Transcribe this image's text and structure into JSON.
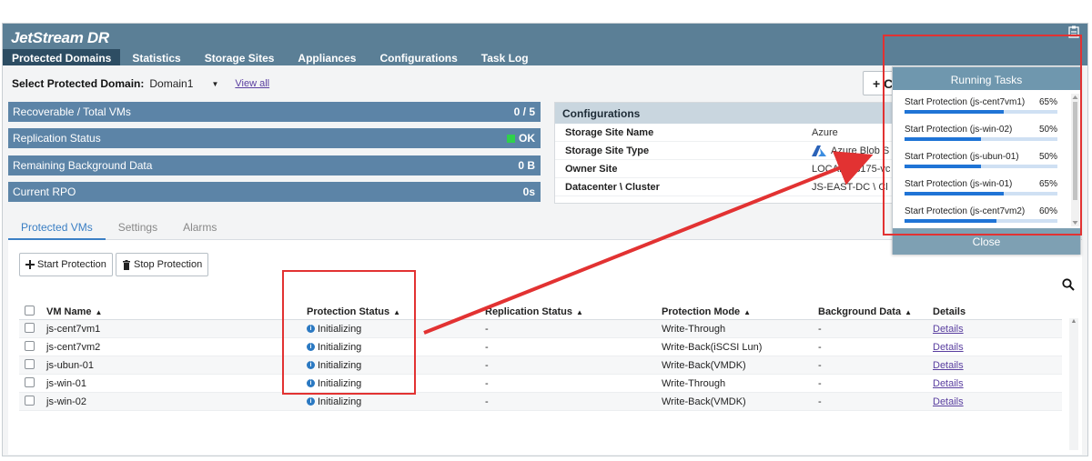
{
  "app": {
    "brand": "JetStream DR",
    "nav": [
      "Protected Domains",
      "Statistics",
      "Storage Sites",
      "Appliances",
      "Configurations",
      "Task Log"
    ],
    "active_nav": "Protected Domains"
  },
  "domain_select": {
    "label": "Select Protected Domain:",
    "value": "Domain1",
    "view_all": "View all"
  },
  "metrics": [
    {
      "label": "Recoverable / Total VMs",
      "value": "0 / 5"
    },
    {
      "label": "Replication Status",
      "value": "OK"
    },
    {
      "label": "Remaining Background Data",
      "value": "0 B"
    },
    {
      "label": "Current RPO",
      "value": "0s"
    }
  ],
  "configurations": {
    "title": "Configurations",
    "rows": [
      {
        "key": "Storage Site Name",
        "value": "Azure"
      },
      {
        "key": "Storage Site Type",
        "value": "Azure Blob S"
      },
      {
        "key": "Owner Site",
        "value": "LOCAL ( is175-vc"
      },
      {
        "key": "Datacenter \\ Cluster",
        "value": "JS-EAST-DC \\ Cl"
      }
    ]
  },
  "add_button": "+ C",
  "tabs": [
    "Protected VMs",
    "Settings",
    "Alarms"
  ],
  "toolbar": {
    "start_protection": "Start Protection",
    "stop_protection": "Stop Protection"
  },
  "table": {
    "columns": [
      "VM Name",
      "Protection Status",
      "Replication Status",
      "Protection Mode",
      "Background Data",
      "Details"
    ],
    "rows": [
      {
        "name": "js-cent7vm1",
        "status": "Initializing",
        "replication": "-",
        "mode": "Write-Through",
        "background": "-",
        "details": "Details"
      },
      {
        "name": "js-cent7vm2",
        "status": "Initializing",
        "replication": "-",
        "mode": "Write-Back(iSCSI Lun)",
        "background": "-",
        "details": "Details"
      },
      {
        "name": "js-ubun-01",
        "status": "Initializing",
        "replication": "-",
        "mode": "Write-Back(VMDK)",
        "background": "-",
        "details": "Details"
      },
      {
        "name": "js-win-01",
        "status": "Initializing",
        "replication": "-",
        "mode": "Write-Through",
        "background": "-",
        "details": "Details"
      },
      {
        "name": "js-win-02",
        "status": "Initializing",
        "replication": "-",
        "mode": "Write-Back(VMDK)",
        "background": "-",
        "details": "Details"
      }
    ]
  },
  "running_tasks": {
    "title": "Running Tasks",
    "close_label": "Close",
    "tasks": [
      {
        "label": "Start Protection (js-cent7vm1)",
        "percent": "65%",
        "progress": 0.65
      },
      {
        "label": "Start Protection (js-win-02)",
        "percent": "50%",
        "progress": 0.5
      },
      {
        "label": "Start Protection (js-ubun-01)",
        "percent": "50%",
        "progress": 0.5
      },
      {
        "label": "Start Protection (js-win-01)",
        "percent": "65%",
        "progress": 0.65
      },
      {
        "label": "Start Protection (js-cent7vm2)",
        "percent": "60%",
        "progress": 0.6
      }
    ]
  },
  "colors": {
    "header_bg": "#5b7f96",
    "active_nav_bg": "#2d4d63",
    "metric_bg": "#5c84a7",
    "status_ok": "#2fd14b",
    "progress_fill": "#1f74d6",
    "annotation": "#e23232"
  },
  "icons": {
    "clipboard": "clipboard-icon",
    "azure": "azure-icon",
    "plus": "plus-icon",
    "trash": "trash-icon",
    "search": "search-icon",
    "info": "info-icon"
  }
}
